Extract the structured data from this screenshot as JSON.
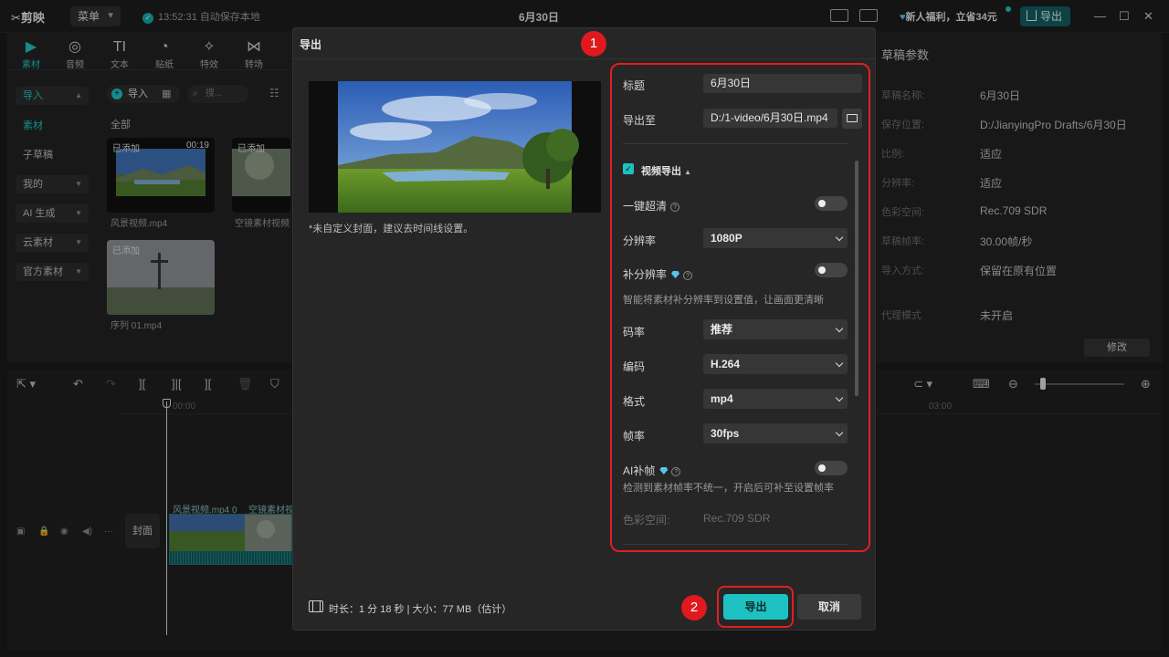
{
  "app": {
    "logo": "剪映",
    "menu_label": "菜单",
    "autosave": "13:52:31 自动保存本地",
    "project_title": "6月30日",
    "promo": "新人福利，立省34元",
    "export_label": "导出"
  },
  "toolbar_tabs": [
    {
      "label": "素材",
      "icon": "media-icon"
    },
    {
      "label": "音频",
      "icon": "audio-icon"
    },
    {
      "label": "文本",
      "icon": "text-icon"
    },
    {
      "label": "贴纸",
      "icon": "sticker-icon"
    },
    {
      "label": "特效",
      "icon": "effects-icon"
    },
    {
      "label": "转场",
      "icon": "transition-icon"
    }
  ],
  "media_sidebar": [
    {
      "label": "导入"
    },
    {
      "label": "素材"
    },
    {
      "label": "子草稿"
    },
    {
      "label": "我的"
    },
    {
      "label": "AI 生成"
    },
    {
      "label": "云素材"
    },
    {
      "label": "官方素材"
    }
  ],
  "media": {
    "import_label": "导入",
    "search_placeholder": "搜...",
    "all_label": "全部",
    "items": [
      {
        "badge": "已添加",
        "duration": "00:19",
        "name": "风景视频.mp4"
      },
      {
        "badge": "已添加",
        "duration": "",
        "name": "空镜素材视频"
      },
      {
        "badge": "已添加",
        "duration": "",
        "name": "序列 01.mp4"
      }
    ]
  },
  "draft": {
    "title": "草稿参数",
    "fields": [
      {
        "key": "草稿名称:",
        "value": "6月30日"
      },
      {
        "key": "保存位置:",
        "value": "D:/JianyingPro Drafts/6月30日"
      },
      {
        "key": "比例:",
        "value": "适应"
      },
      {
        "key": "分辨率:",
        "value": "适应"
      },
      {
        "key": "色彩空间:",
        "value": "Rec.709 SDR"
      },
      {
        "key": "草稿帧率:",
        "value": "30.00帧/秒"
      },
      {
        "key": "导入方式:",
        "value": "保留在原有位置"
      },
      {
        "key": "代理模式",
        "value": "未开启"
      }
    ],
    "modify_label": "修改"
  },
  "timeline": {
    "cover_label": "封面",
    "timecode_start": "00:00",
    "timecode_3": "03:00",
    "clip1": "风景视频.mp4",
    "clip1_dur": "0",
    "clip2": "空镜素材视"
  },
  "dialog": {
    "title": "导出",
    "cover_note": "*未自定义封面，建议去时间线设置。",
    "title_label": "标题",
    "title_value": "6月30日",
    "export_to_label": "导出至",
    "export_to_value": "D:/1-video/6月30日.mp4",
    "video_export_label": "视频导出",
    "one_click_hd": "一键超清",
    "resolution_label": "分辨率",
    "resolution_value": "1080P",
    "super_res_label": "补分辨率",
    "super_res_hint": "智能将素材补分辨率到设置值，让画面更清晰",
    "bitrate_label": "码率",
    "bitrate_value": "推荐",
    "codec_label": "编码",
    "codec_value": "H.264",
    "format_label": "格式",
    "format_value": "mp4",
    "fps_label": "帧率",
    "fps_value": "30fps",
    "ai_frame_label": "AI补帧",
    "ai_frame_hint": "检测到素材帧率不统一，开启后可补至设置帧率",
    "color_space_label": "色彩空间:",
    "color_space_value": "Rec.709 SDR",
    "footer_info": "时长：1 分 18 秒 | 大小：77 MB（估计）",
    "export_button": "导出",
    "cancel_button": "取消"
  },
  "annotations": {
    "step1": "1",
    "step2": "2"
  },
  "colors": {
    "accent": "#1ec1c1",
    "highlight": "#e01f1f"
  }
}
